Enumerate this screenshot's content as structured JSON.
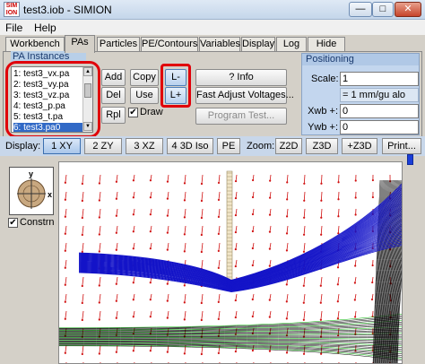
{
  "window": {
    "title": "test3.iob - SIMION",
    "icon_label": "SIM ION",
    "minimize_glyph": "—",
    "maximize_glyph": "□",
    "close_glyph": "✕"
  },
  "menu": {
    "file": "File",
    "help": "Help"
  },
  "tabs": [
    {
      "label": "Workbench"
    },
    {
      "label": "PAs"
    },
    {
      "label": "Particles"
    },
    {
      "label": "PE/Contours"
    },
    {
      "label": "Variables"
    },
    {
      "label": "Display"
    },
    {
      "label": "Log"
    },
    {
      "label": "Hide"
    }
  ],
  "pa_instances": {
    "group_title": "PA Instances",
    "items": [
      {
        "label": "1: test3_vx.pa"
      },
      {
        "label": "2: test3_vy.pa"
      },
      {
        "label": "3: test3_vz.pa"
      },
      {
        "label": "4: test3_p.pa"
      },
      {
        "label": "5: test3_t.pa"
      },
      {
        "label": "6: test3.pa0"
      }
    ],
    "selected_index": 5
  },
  "buttons": {
    "add": "Add",
    "copy": "Copy",
    "l_minus": "L-",
    "info": "? Info",
    "del": "Del",
    "use": "Use",
    "l_plus": "L+",
    "fast_adjust": "Fast Adjust Voltages...",
    "rpl": "Rpl",
    "program_test": "Program Test..."
  },
  "draw_checkbox": {
    "label": "Draw",
    "checked": true
  },
  "positioning": {
    "title": "Positioning",
    "scale_label": "Scale:",
    "scale_value": "1",
    "unit_text": "= 1 mm/gu alo",
    "xwb_label": "Xwb +:",
    "xwb_value": "0",
    "ywb_label": "Ywb +:",
    "ywb_value": "0"
  },
  "display_bar": {
    "display_label": "Display:",
    "view_buttons": [
      "1 XY",
      "2 ZY",
      "3 XZ",
      "4 3D Iso",
      "PE"
    ],
    "selected_view": "1 XY",
    "zoom_label": "Zoom:",
    "zoom_buttons": [
      "Z2D",
      "Z3D",
      "+Z3D"
    ],
    "print_button": "Print..."
  },
  "mini_view": {
    "y_axis": "y",
    "x_axis": "x"
  },
  "constrn": {
    "label": "Constrn",
    "checked": true
  },
  "colors": {
    "trajectories": "#1414c8",
    "vectors": "#d01010",
    "highlight": "#e0000a",
    "secondary_trajectories": "#000000",
    "green_trajectories": "#00b400"
  }
}
